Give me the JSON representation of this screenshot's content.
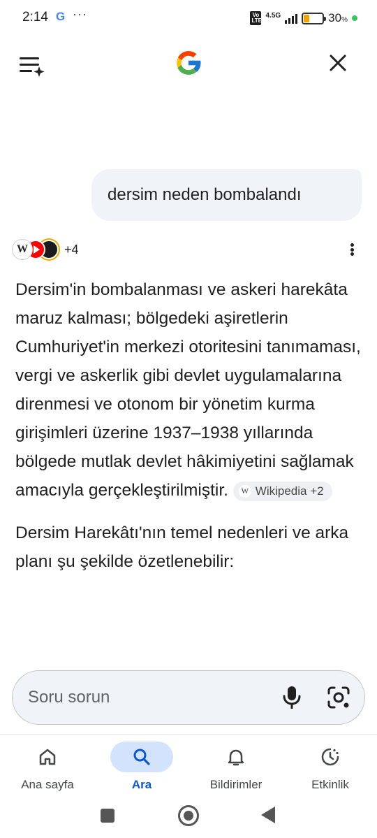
{
  "status_bar": {
    "time": "2:14",
    "notification_icons": [
      "google-icon",
      "more-icon"
    ],
    "network_badge": "Vo LTE",
    "network_type": "4.5G",
    "battery_percent": "30",
    "battery_unit": "%",
    "battery_level": 0.3
  },
  "header": {
    "menu_icon": "menu-sparkle-icon",
    "logo": "google-g-logo",
    "close_icon": "close-icon"
  },
  "query": {
    "text": "dersim neden bombalandı"
  },
  "sources": {
    "icons": [
      "wikipedia-icon",
      "youtube-icon",
      "source-icon"
    ],
    "more_count": "+4"
  },
  "answer": {
    "paragraph1": "Dersim'in bombalanması ve askeri harekâta maruz kalması; bölgedeki aşiretlerin Cumhuriyet'in merkezi otoritesini tanımaması, vergi ve askerlik gibi devlet uygulamalarına direnmesi ve otonom bir yönetim kurma girişimleri üzerine 1937–1938 yıllarında bölgede mutlak devlet hâkimiyetini sağlamak amacıyla gerçekleştirilmiştir.",
    "citation_label": "Wikipedia +2",
    "paragraph2": "Dersim Harekâtı'nın temel nedenleri ve arka planı şu şekilde özetlenebilir:"
  },
  "input": {
    "placeholder": "Soru sorun"
  },
  "bottom_nav": {
    "items": [
      {
        "label": "Ana sayfa",
        "icon": "home-icon"
      },
      {
        "label": "Ara",
        "icon": "search-icon",
        "active": true
      },
      {
        "label": "Bildirimler",
        "icon": "bell-icon"
      },
      {
        "label": "Etkinlik",
        "icon": "activity-icon"
      }
    ]
  },
  "colors": {
    "accent": "#0b57d0",
    "active_pill": "#d3e3fd",
    "bubble": "#f0f4f9"
  }
}
